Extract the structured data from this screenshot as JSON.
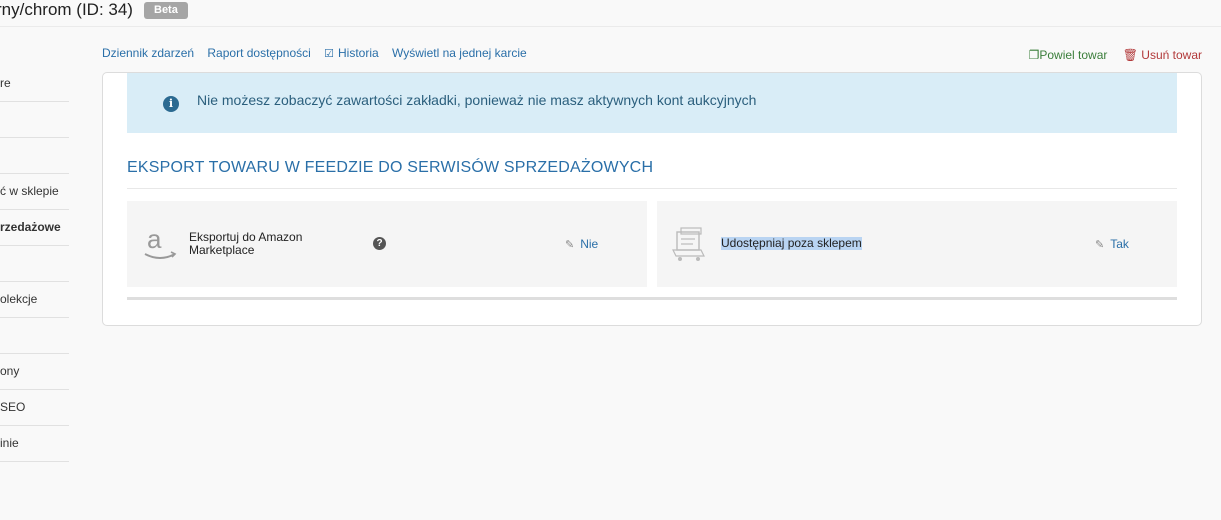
{
  "header": {
    "title": "rny/chrom (ID: 34)",
    "badge": "Beta"
  },
  "sidebar": {
    "items": [
      {
        "label": "re"
      },
      {
        "label": ""
      },
      {
        "label": ""
      },
      {
        "label": "ć w sklepie"
      },
      {
        "label": "rzedażowe"
      },
      {
        "label": ""
      },
      {
        "label": "olekcje"
      },
      {
        "label": ""
      },
      {
        "label": "ony"
      },
      {
        "label": "SEO"
      },
      {
        "label": "inie"
      }
    ]
  },
  "toplinks": {
    "dziennik": "Dziennik zdarzeń",
    "raport": "Raport dostępności",
    "historia": "Historia",
    "jedna_karta": "Wyświetl na jednej karcie"
  },
  "actions": {
    "copy": "Powiel towar",
    "delete": "Usuń towar"
  },
  "alert": {
    "message": "Nie możesz zobaczyć zawartości zakładki, ponieważ nie masz aktywnych kont aukcyjnych"
  },
  "section": {
    "title": "EKSPORT TOWARU W FEEDZIE DO SERWISÓW SPRZEDAŻOWYCH"
  },
  "cards": {
    "amazon": {
      "label_line1": "Eksportuj do Amazon",
      "label_line2": "Marketplace",
      "value": "Nie"
    },
    "share": {
      "label": "Udostępniaj poza sklepem",
      "value": "Tak"
    }
  },
  "icons": {
    "info": "info-icon",
    "help": "question-icon",
    "edit": "pencil-icon",
    "copy": "copy-icon",
    "trash": "trash-icon",
    "history": "edit-square-icon"
  }
}
